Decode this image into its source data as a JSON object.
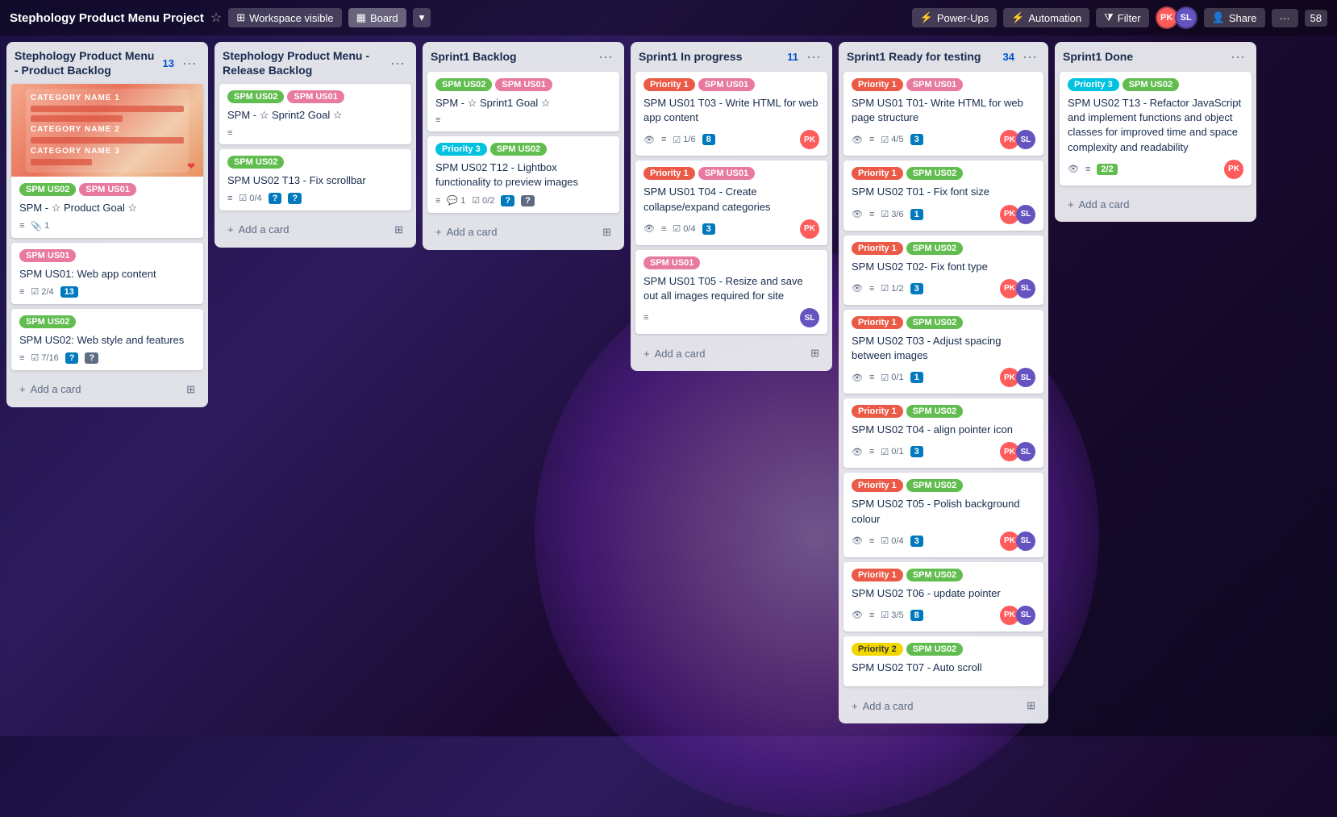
{
  "header": {
    "project_title": "Stephology Product Menu Project",
    "workspace_label": "Workspace visible",
    "board_label": "Board",
    "power_ups_label": "Power-Ups",
    "automation_label": "Automation",
    "filter_label": "Filter",
    "share_label": "Share",
    "notification_count": "58",
    "avatar_pk_initials": "PK",
    "avatar_sl_initials": "SL",
    "avatar_pk_color": "#ff5c5c",
    "avatar_sl_color": "#6554c0"
  },
  "columns": [
    {
      "id": "product-backlog",
      "title": "Stephology Product Menu - Product Backlog",
      "count": "13",
      "cards": [
        {
          "id": "pb1",
          "has_image": true,
          "tags": [
            {
              "label": "SPM US02",
              "color": "green"
            },
            {
              "label": "SPM US01",
              "color": "pink"
            }
          ],
          "title": "SPM - ☆ Product Goal ☆",
          "meta": [
            {
              "type": "text",
              "icon": "≡"
            },
            {
              "type": "clip",
              "icon": "📎",
              "value": "1"
            }
          ]
        },
        {
          "id": "pb2",
          "tags": [
            {
              "label": "SPM US01",
              "color": "pink"
            }
          ],
          "title": "SPM US01: Web app content",
          "meta": [
            {
              "type": "text",
              "icon": "≡"
            },
            {
              "type": "check",
              "value": "2/4"
            },
            {
              "type": "badge",
              "value": "13",
              "style": "blue"
            }
          ]
        },
        {
          "id": "pb3",
          "tags": [
            {
              "label": "SPM US02",
              "color": "green"
            }
          ],
          "title": "SPM US02: Web style and features",
          "meta": [
            {
              "type": "text",
              "icon": "≡"
            },
            {
              "type": "check",
              "value": "7/16"
            },
            {
              "type": "badge",
              "value": "?",
              "style": "blue"
            },
            {
              "type": "badge2",
              "value": "?",
              "style": "gray"
            }
          ]
        }
      ]
    },
    {
      "id": "release-backlog",
      "title": "Stephology Product Menu - Release Backlog",
      "count": "",
      "cards": [
        {
          "id": "rb1",
          "tags": [
            {
              "label": "SPM US02",
              "color": "green"
            },
            {
              "label": "SPM US01",
              "color": "pink"
            }
          ],
          "title": "SPM - ☆ Sprint2 Goal ☆",
          "meta": [
            {
              "type": "text",
              "icon": "≡"
            }
          ]
        },
        {
          "id": "rb2",
          "tags": [
            {
              "label": "SPM US02",
              "color": "green"
            }
          ],
          "title": "SPM US02 T13 - Fix scrollbar",
          "meta": [
            {
              "type": "text",
              "icon": "≡"
            },
            {
              "type": "check",
              "value": "0/4"
            },
            {
              "type": "badge",
              "value": "?",
              "style": "blue"
            },
            {
              "type": "badge2",
              "value": "?",
              "style": "blue"
            }
          ]
        }
      ]
    },
    {
      "id": "sprint1-backlog",
      "title": "Sprint1 Backlog",
      "count": "",
      "cards": [
        {
          "id": "sb1",
          "tags": [
            {
              "label": "SPM US02",
              "color": "green"
            },
            {
              "label": "SPM US01",
              "color": "pink"
            }
          ],
          "title": "SPM - ☆ Sprint1 Goal ☆",
          "meta": [
            {
              "type": "text",
              "icon": "≡"
            }
          ]
        },
        {
          "id": "sb2",
          "tags": [
            {
              "label": "Priority 3",
              "color": "teal"
            },
            {
              "label": "SPM US02",
              "color": "green"
            }
          ],
          "title": "SPM US02 T12 - Lightbox functionality to preview images",
          "meta": [
            {
              "type": "text",
              "icon": "≡"
            },
            {
              "type": "comment",
              "value": "1"
            },
            {
              "type": "check",
              "value": "0/2"
            },
            {
              "type": "badge",
              "value": "?",
              "style": "blue"
            },
            {
              "type": "badge2",
              "value": "?",
              "style": "gray"
            }
          ]
        }
      ]
    },
    {
      "id": "sprint1-inprogress",
      "title": "Sprint1 In progress",
      "count": "11",
      "cards": [
        {
          "id": "ip1",
          "tags": [
            {
              "label": "Priority 1",
              "color": "red"
            },
            {
              "label": "SPM US01",
              "color": "pink"
            }
          ],
          "title": "SPM US01 T03 - Write HTML for web app content",
          "meta": [
            {
              "type": "text",
              "icon": "≡"
            },
            {
              "type": "eye"
            },
            {
              "type": "check",
              "value": "1/6"
            },
            {
              "type": "badge",
              "value": "8",
              "style": "blue"
            }
          ],
          "avatars": [
            {
              "initials": "PK",
              "color": "#ff5c5c"
            }
          ]
        },
        {
          "id": "ip2",
          "tags": [
            {
              "label": "Priority 1",
              "color": "red"
            },
            {
              "label": "SPM US01",
              "color": "pink"
            }
          ],
          "title": "SPM US01 T04 - Create collapse/expand categories",
          "meta": [
            {
              "type": "text",
              "icon": "≡"
            },
            {
              "type": "eye"
            },
            {
              "type": "check",
              "value": "0/4"
            },
            {
              "type": "badge",
              "value": "3",
              "style": "blue"
            }
          ],
          "avatars": [
            {
              "initials": "PK",
              "color": "#ff5c5c"
            }
          ]
        },
        {
          "id": "ip3",
          "tags": [
            {
              "label": "SPM US01",
              "color": "pink"
            }
          ],
          "title": "SPM US01 T05 - Resize and save out all images required for site",
          "meta": [
            {
              "type": "text",
              "icon": "≡"
            }
          ],
          "avatars": [
            {
              "initials": "SL",
              "color": "#6554c0"
            }
          ]
        }
      ]
    },
    {
      "id": "sprint1-ready",
      "title": "Sprint1 Ready for testing",
      "count": "34",
      "cards": [
        {
          "id": "rt1",
          "tags": [
            {
              "label": "Priority 1",
              "color": "red"
            },
            {
              "label": "SPM US01",
              "color": "pink"
            }
          ],
          "title": "SPM US01 T01- Write HTML for web page structure",
          "meta": [
            {
              "type": "eye"
            },
            {
              "type": "text"
            },
            {
              "type": "check",
              "value": "4/5"
            },
            {
              "type": "badge",
              "value": "3",
              "style": "blue"
            }
          ],
          "avatars": [
            {
              "initials": "PK",
              "color": "#ff5c5c"
            },
            {
              "initials": "SL",
              "color": "#6554c0"
            }
          ]
        },
        {
          "id": "rt2",
          "tags": [
            {
              "label": "Priority 1",
              "color": "red"
            },
            {
              "label": "SPM US02",
              "color": "green"
            }
          ],
          "title": "SPM US02 T01 - Fix font size",
          "meta": [
            {
              "type": "eye"
            },
            {
              "type": "text"
            },
            {
              "type": "check",
              "value": "3/6"
            },
            {
              "type": "badge",
              "value": "1",
              "style": "blue"
            }
          ],
          "avatars": [
            {
              "initials": "PK",
              "color": "#ff5c5c"
            },
            {
              "initials": "SL",
              "color": "#6554c0"
            }
          ]
        },
        {
          "id": "rt3",
          "tags": [
            {
              "label": "Priority 1",
              "color": "red"
            },
            {
              "label": "SPM US02",
              "color": "green"
            }
          ],
          "title": "SPM US02 T02- Fix font type",
          "meta": [
            {
              "type": "eye"
            },
            {
              "type": "text"
            },
            {
              "type": "check",
              "value": "1/2"
            },
            {
              "type": "badge",
              "value": "3",
              "style": "blue"
            }
          ],
          "avatars": [
            {
              "initials": "PK",
              "color": "#ff5c5c"
            },
            {
              "initials": "SL",
              "color": "#6554c0"
            }
          ]
        },
        {
          "id": "rt4",
          "tags": [
            {
              "label": "Priority 1",
              "color": "red"
            },
            {
              "label": "SPM US02",
              "color": "green"
            }
          ],
          "title": "SPM US02 T03 - Adjust spacing between images",
          "meta": [
            {
              "type": "eye"
            },
            {
              "type": "text"
            },
            {
              "type": "check",
              "value": "0/1"
            },
            {
              "type": "badge",
              "value": "1",
              "style": "blue"
            }
          ],
          "avatars": [
            {
              "initials": "PK",
              "color": "#ff5c5c"
            },
            {
              "initials": "SL",
              "color": "#6554c0"
            }
          ]
        },
        {
          "id": "rt5",
          "tags": [
            {
              "label": "Priority 1",
              "color": "red"
            },
            {
              "label": "SPM US02",
              "color": "green"
            }
          ],
          "title": "SPM US02 T04 - align pointer icon",
          "meta": [
            {
              "type": "eye"
            },
            {
              "type": "text"
            },
            {
              "type": "check",
              "value": "0/1"
            },
            {
              "type": "badge",
              "value": "3",
              "style": "blue"
            }
          ],
          "avatars": [
            {
              "initials": "PK",
              "color": "#ff5c5c"
            },
            {
              "initials": "SL",
              "color": "#6554c0"
            }
          ]
        },
        {
          "id": "rt6",
          "tags": [
            {
              "label": "Priority 1",
              "color": "red"
            },
            {
              "label": "SPM US02",
              "color": "green"
            }
          ],
          "title": "SPM US02 T05 - Polish background colour",
          "meta": [
            {
              "type": "eye"
            },
            {
              "type": "text"
            },
            {
              "type": "check",
              "value": "0/4"
            },
            {
              "type": "badge",
              "value": "3",
              "style": "blue"
            }
          ],
          "avatars": [
            {
              "initials": "PK",
              "color": "#ff5c5c"
            },
            {
              "initials": "SL",
              "color": "#6554c0"
            }
          ]
        },
        {
          "id": "rt7",
          "tags": [
            {
              "label": "Priority 1",
              "color": "red"
            },
            {
              "label": "SPM US02",
              "color": "green"
            }
          ],
          "title": "SPM US02 T06 - update pointer",
          "meta": [
            {
              "type": "eye"
            },
            {
              "type": "text"
            },
            {
              "type": "check",
              "value": "3/5"
            },
            {
              "type": "badge",
              "value": "8",
              "style": "blue"
            }
          ],
          "avatars": [
            {
              "initials": "PK",
              "color": "#ff5c5c"
            },
            {
              "initials": "SL",
              "color": "#6554c0"
            }
          ]
        },
        {
          "id": "rt8",
          "tags": [
            {
              "label": "Priority 2",
              "color": "yellow"
            },
            {
              "label": "SPM US02",
              "color": "green"
            }
          ],
          "title": "SPM US02 T07 - Auto scroll",
          "meta": [],
          "avatars": []
        }
      ]
    },
    {
      "id": "sprint1-done",
      "title": "Sprint1 Done",
      "count": "",
      "cards": [
        {
          "id": "d1",
          "tags": [
            {
              "label": "Priority 3",
              "color": "teal"
            },
            {
              "label": "SPM US02",
              "color": "green"
            }
          ],
          "title": "SPM US02 T13 - Refactor JavaScript and implement functions and object classes for improved time and space complexity and readability",
          "meta": [
            {
              "type": "eye"
            },
            {
              "type": "text"
            },
            {
              "type": "badge-green",
              "value": "2/2"
            }
          ],
          "avatars": [
            {
              "initials": "PK",
              "color": "#ff5c5c"
            }
          ]
        }
      ]
    }
  ],
  "labels": {
    "add_card": "+ Add a card",
    "add_card_icon": "+"
  }
}
